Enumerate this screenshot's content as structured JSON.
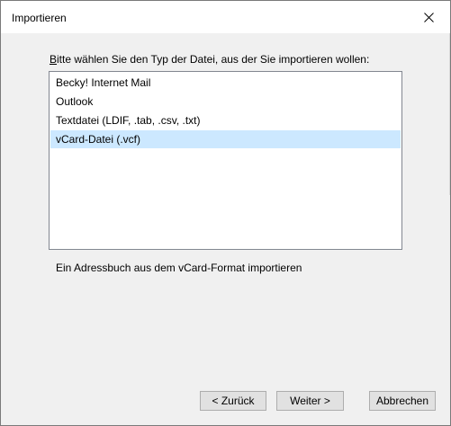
{
  "window": {
    "title": "Importieren"
  },
  "prompt": {
    "accel": "B",
    "rest": "itte wählen Sie den Typ der Datei, aus der Sie importieren wollen:"
  },
  "list": {
    "items": [
      {
        "label": "Becky! Internet Mail",
        "selected": false
      },
      {
        "label": "Outlook",
        "selected": false
      },
      {
        "label": "Textdatei (LDIF, .tab, .csv, .txt)",
        "selected": false
      },
      {
        "label": "vCard-Datei (.vcf)",
        "selected": true
      }
    ]
  },
  "description": "Ein Adressbuch aus dem vCard-Format importieren",
  "buttons": {
    "back": "< Zurück",
    "next": "Weiter >",
    "cancel": "Abbrechen"
  },
  "colors": {
    "selection": "#cce8ff",
    "border": "#828790",
    "button_bg": "#e1e1e1"
  }
}
